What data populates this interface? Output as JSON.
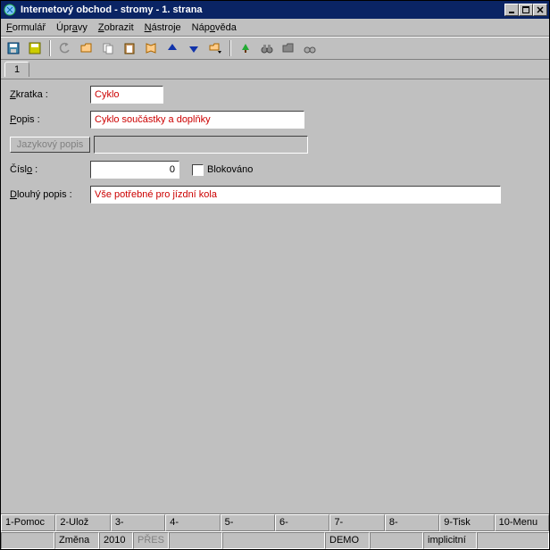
{
  "window": {
    "title": "Internetový obchod - stromy - 1. strana"
  },
  "menu": {
    "formular": "Formulář",
    "upravy": "Úpravy",
    "zobrazit": "Zobrazit",
    "nastroje": "Nástroje",
    "napoveda": "Nápověda"
  },
  "tabs": {
    "t1": "1"
  },
  "form": {
    "zkratka_label": "Zkratka :",
    "zkratka_value": "Cyklo",
    "popis_label": "Popis :",
    "popis_value": "Cyklo součástky a doplňky",
    "jazykovy_btn": "Jazykový popis",
    "jazykovy_value": "",
    "cislo_label": "Číslo :",
    "cislo_value": "0",
    "blokovano_label": "Blokováno",
    "dlouhy_label": "Dlouhý popis :",
    "dlouhy_value": "Vše potřebné pro jízdní kola"
  },
  "fnkeys": {
    "f1": "1-Pomoc",
    "f2": "2-Ulož",
    "f3": "3-",
    "f4": "4-",
    "f5": "5-",
    "f6": "6-",
    "f7": "7-",
    "f8": "8-",
    "f9": "9-Tisk",
    "f10": "10-Menu"
  },
  "status": {
    "s1": "",
    "s2": "Změna",
    "s3": "2010",
    "s4": "PŘES",
    "s5": "",
    "s6": "",
    "s7": "DEMO",
    "s8": "",
    "s9": "implicitní",
    "s10": ""
  }
}
